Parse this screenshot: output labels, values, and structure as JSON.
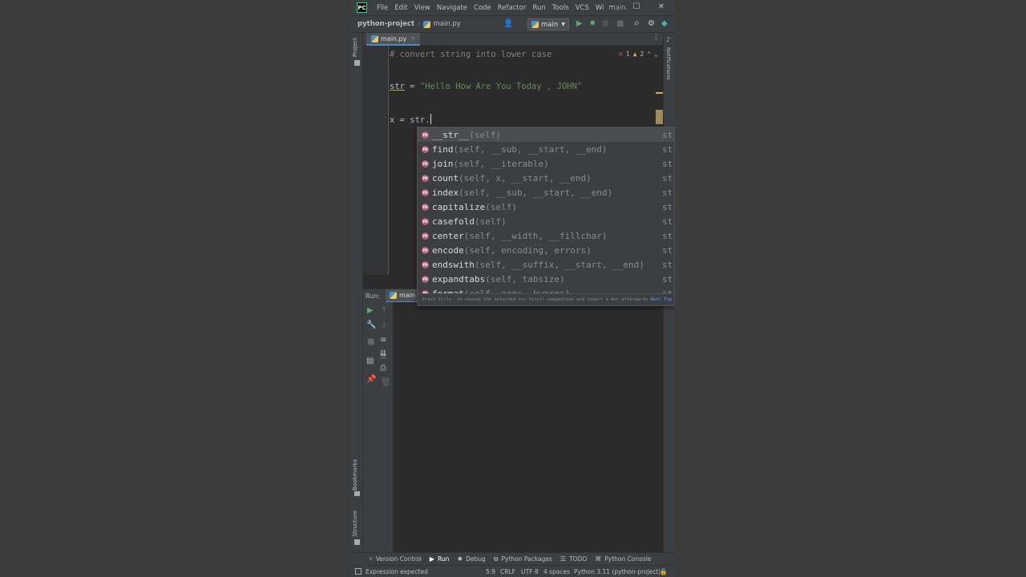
{
  "menu": [
    "File",
    "Edit",
    "View",
    "Navigate",
    "Code",
    "Refactor",
    "Run",
    "Tools",
    "VCS",
    "Wi"
  ],
  "window": {
    "title": "main.",
    "minimize": "─",
    "maximize": "☐",
    "close": "✕"
  },
  "breadcrumb": {
    "project": "python-project",
    "file": "main.py"
  },
  "run_config": {
    "label": "main"
  },
  "icons": {
    "app_logo": "PC",
    "vcs_user": "👤",
    "run": "▶",
    "debug": "✹",
    "coverage": "◍",
    "stop": "■",
    "search": "⌕",
    "settings": "⚙",
    "plugins": "◆"
  },
  "editor_tab": {
    "label": "main.py",
    "close": "×",
    "more": "⋮"
  },
  "inspections": {
    "errors": "1",
    "warnings": "2",
    "error_icon": "⊘",
    "warning_icon": "▲",
    "up": "⌃",
    "down": "⌄"
  },
  "code": {
    "line1": "# convert string into lower case",
    "line2_var": "str",
    "line2_eq": " = ",
    "line2_str": "\"Hello How Are You Today , JOHN\"",
    "line3_pre": "x = str."
  },
  "completion": {
    "items": [
      {
        "name": "__str__",
        "args": "(self)",
        "type": "str"
      },
      {
        "name": "find",
        "args": "(self, __sub, __start, __end)",
        "type": "str"
      },
      {
        "name": "join",
        "args": "(self, __iterable)",
        "type": "str"
      },
      {
        "name": "count",
        "args": "(self, x, __start, __end)",
        "type": "str"
      },
      {
        "name": "index",
        "args": "(self, __sub, __start, __end)",
        "type": "str"
      },
      {
        "name": "capitalize",
        "args": "(self)",
        "type": "str"
      },
      {
        "name": "casefold",
        "args": "(self)",
        "type": "str"
      },
      {
        "name": "center",
        "args": "(self, __width, __fillchar)",
        "type": "str"
      },
      {
        "name": "encode",
        "args": "(self, encoding, errors)",
        "type": "str"
      },
      {
        "name": "endswith",
        "args": "(self, __suffix, __start, __end)",
        "type": "str"
      },
      {
        "name": "expandtabs",
        "args": "(self, tabsize)",
        "type": "str"
      },
      {
        "name": "format",
        "args": "(self, args, kwargs)",
        "type": "str"
      }
    ],
    "method_badge": "m",
    "footer": "Press Ctrl+. to choose the selected (or first) suggestion and insert a dot afterwards",
    "next_tip": "Next Tip"
  },
  "left_strip": {
    "project": "Project",
    "bookmarks": "Bookmarks",
    "structure": "Structure"
  },
  "right_strip": {
    "notifications": "Notifications"
  },
  "run_panel": {
    "label": "Run:",
    "tab": "main"
  },
  "bottom_tools": [
    {
      "icon": "⑂",
      "label": "Version Control"
    },
    {
      "icon": "▶",
      "label": "Run"
    },
    {
      "icon": "✹",
      "label": "Debug"
    },
    {
      "icon": "⧉",
      "label": "Python Packages"
    },
    {
      "icon": "☰",
      "label": "TODO"
    },
    {
      "icon": "⌘",
      "label": "Python Console"
    }
  ],
  "status": {
    "message": "Expression expected",
    "position": "5:9",
    "line_ending": "CRLF",
    "encoding": "UTF-8",
    "indent": "4 spaces",
    "interpreter": "Python 3.11 (python-project)",
    "lock": "🔓"
  }
}
